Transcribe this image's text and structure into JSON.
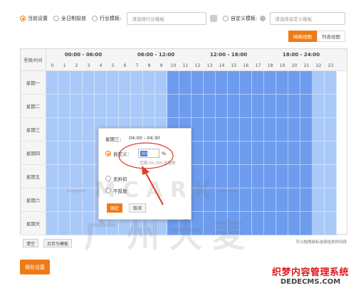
{
  "options": {
    "current": "当前设置",
    "allday": "全日制投放",
    "industry": "行业模板:",
    "industry_placeholder": "请选择行业模板",
    "custom": "自定义模板:",
    "custom_placeholder": "请选择自定义模板"
  },
  "view_tabs": [
    "网格视图",
    "列表视图"
  ],
  "grid": {
    "corner": "星期/时间",
    "ranges": [
      "00:00 - 06:00",
      "06:00 - 12:00",
      "12:00 - 18:00",
      "18:00 - 24:00"
    ],
    "hours": [
      "0",
      "1",
      "2",
      "3",
      "4",
      "5",
      "6",
      "7",
      "8",
      "9",
      "10",
      "11",
      "12",
      "13",
      "14",
      "15",
      "16",
      "17",
      "18",
      "19",
      "20",
      "21",
      "22",
      "23"
    ],
    "days": [
      "星期一",
      "星期二",
      "星期三",
      "星期四",
      "星期五",
      "星期六",
      "星期天"
    ]
  },
  "popup": {
    "title": "星期三：",
    "time": "04:00 - 04:30",
    "custom_label": "自定义：",
    "custom_value": "30",
    "percent": "%",
    "range_hint": "范围:30-250 的整数",
    "no_discount": "无折扣",
    "no_delivery": "不投放",
    "ok": "确定",
    "cancel": "取消"
  },
  "bottom": {
    "clear": "清空",
    "save_template": "另存为模板",
    "hint": "可以拖拽鼠标选择投放时间段",
    "save": "保存设置"
  },
  "watermark": {
    "mcark": "—  M C A R K  —",
    "company": "广州大麦"
  },
  "site_mark": {
    "cn": "织梦内容管理系统",
    "url": "DEDECMS.COM"
  },
  "colors": {
    "accent": "#f07a16",
    "cell_light": "#a9c9f9",
    "cell_dark": "#6d9cee",
    "annotation": "#e23a2a"
  }
}
